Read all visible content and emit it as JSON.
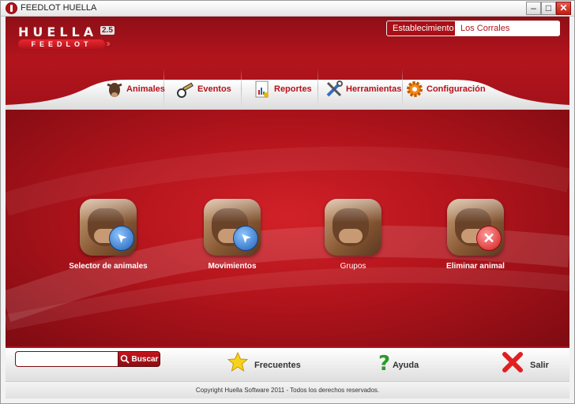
{
  "window": {
    "title": "FEEDLOT HUELLA",
    "controls": {
      "minimize": "–",
      "maximize": "□",
      "close": "✕"
    }
  },
  "logo": {
    "name": "HUELLA",
    "version": "2.5",
    "subtitle": "FEEDLOT",
    "arrows": "›››"
  },
  "establishment": {
    "label": "Establecimiento",
    "value": "Los Corrales"
  },
  "tabs": [
    {
      "label": "Animales",
      "icon": "cow-head-icon"
    },
    {
      "label": "Eventos",
      "icon": "syringe-icon"
    },
    {
      "label": "Reportes",
      "icon": "report-chart-icon"
    },
    {
      "label": "Herramientas",
      "icon": "tools-icon"
    },
    {
      "label": "Configuración",
      "icon": "gear-icon"
    }
  ],
  "tiles": [
    {
      "label": "Selector de animales",
      "icon": "cow-select-icon",
      "badge": "arrow"
    },
    {
      "label": "Movimientos",
      "icon": "cow-move-icon",
      "badge": "arrow"
    },
    {
      "label": "Grupos",
      "icon": "cow-group-icon",
      "badge": "none"
    },
    {
      "label": "Eliminar animal",
      "icon": "cow-delete-icon",
      "badge": "x"
    }
  ],
  "footer": {
    "search_placeholder": "",
    "search_button": "Buscar",
    "frequent": "Frecuentes",
    "help": "Ayuda",
    "exit": "Salir"
  },
  "copyright": "Copyright Huella Software 2011 - Todos los derechos reservados.",
  "colors": {
    "brand_red": "#b5121b",
    "dark_red": "#7e0b12",
    "white": "#ffffff"
  }
}
